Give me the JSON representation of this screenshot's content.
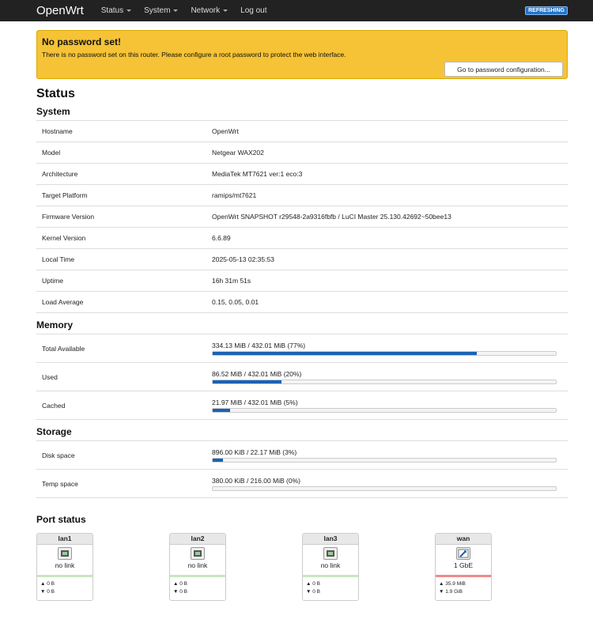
{
  "nav": {
    "brand": "OpenWrt",
    "items": [
      {
        "label": "Status",
        "dropdown": true
      },
      {
        "label": "System",
        "dropdown": true
      },
      {
        "label": "Network",
        "dropdown": true
      },
      {
        "label": "Log out",
        "dropdown": false
      }
    ],
    "badge": "REFRESHING"
  },
  "alert": {
    "title": "No password set!",
    "text": "There is no password set on this router. Please configure a root password to protect the web interface.",
    "button": "Go to password configuration..."
  },
  "page_title": "Status",
  "system": {
    "heading": "System",
    "rows": [
      {
        "key": "Hostname",
        "value": "OpenWrt"
      },
      {
        "key": "Model",
        "value": "Netgear WAX202"
      },
      {
        "key": "Architecture",
        "value": "MediaTek MT7621 ver:1 eco:3"
      },
      {
        "key": "Target Platform",
        "value": "ramips/mt7621"
      },
      {
        "key": "Firmware Version",
        "value": "OpenWrt SNAPSHOT r29548-2a9316fbfb / LuCI Master 25.130.42692~50bee13"
      },
      {
        "key": "Kernel Version",
        "value": "6.6.89"
      },
      {
        "key": "Local Time",
        "value": "2025-05-13 02:35:53"
      },
      {
        "key": "Uptime",
        "value": "16h 31m 51s"
      },
      {
        "key": "Load Average",
        "value": "0.15, 0.05, 0.01"
      }
    ]
  },
  "memory": {
    "heading": "Memory",
    "rows": [
      {
        "key": "Total Available",
        "label": "334.13 MiB / 432.01 MiB (77%)",
        "percent": 77
      },
      {
        "key": "Used",
        "label": "86.52 MiB / 432.01 MiB (20%)",
        "percent": 20
      },
      {
        "key": "Cached",
        "label": "21.97 MiB / 432.01 MiB (5%)",
        "percent": 5
      }
    ]
  },
  "storage": {
    "heading": "Storage",
    "rows": [
      {
        "key": "Disk space",
        "label": "896.00 KiB / 22.17 MiB (3%)",
        "percent": 3
      },
      {
        "key": "Temp space",
        "label": "380.00 KiB / 216.00 MiB (0%)",
        "percent": 0
      }
    ]
  },
  "ports": {
    "heading": "Port status",
    "items": [
      {
        "name": "lan1",
        "link": "no link",
        "tx": "▲ 0 B",
        "rx": "▼ 0 B",
        "status_color": "#c8e6c0",
        "active": false
      },
      {
        "name": "lan2",
        "link": "no link",
        "tx": "▲ 0 B",
        "rx": "▼ 0 B",
        "status_color": "#c8e6c0",
        "active": false
      },
      {
        "name": "lan3",
        "link": "no link",
        "tx": "▲ 0 B",
        "rx": "▼ 0 B",
        "status_color": "#c8e6c0",
        "active": false
      },
      {
        "name": "wan",
        "link": "1 GbE",
        "tx": "▲ 35.9 MiB",
        "rx": "▼ 1.9 GiB",
        "status_color": "#f08a8a",
        "active": true
      }
    ]
  }
}
